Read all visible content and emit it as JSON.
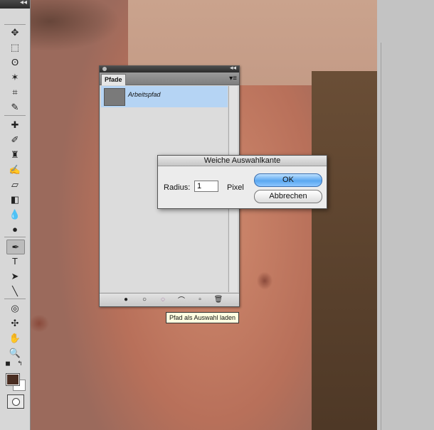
{
  "paths_panel": {
    "tab_label": "Pfade",
    "items": [
      {
        "label": "Arbeitspfad"
      }
    ]
  },
  "tooltip": {
    "text": "Pfad als Auswahl laden"
  },
  "feather_dialog": {
    "title": "Weiche Auswahlkante",
    "radius_label": "Radius:",
    "radius_value": "1",
    "unit_label": "Pixel",
    "ok_label": "OK",
    "cancel_label": "Abbrechen"
  },
  "toolbox": {
    "foreground_color": "#4a2e22",
    "background_color": "#ffffff"
  }
}
